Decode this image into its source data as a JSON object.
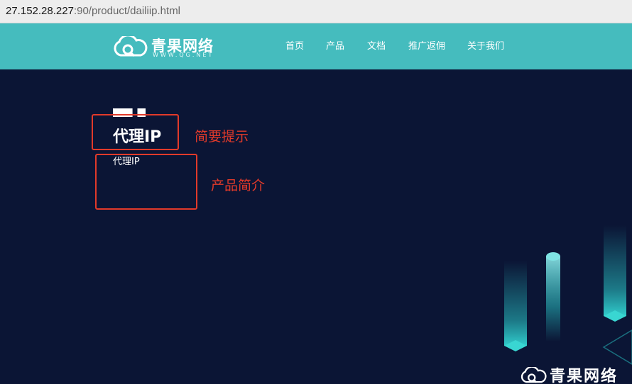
{
  "browser": {
    "url_host": "27.152.28.227",
    "url_rest": ":90/product/dailiip.html"
  },
  "header": {
    "logo_title": "青果网络",
    "logo_subtitle": "WWW.QG.NET",
    "nav": [
      "首页",
      "产品",
      "文档",
      "推广返佣",
      "关于我们"
    ],
    "colors": {
      "header_bg": "#45bcbe",
      "hero_bg": "#0b1535",
      "annotation": "#e23a2a"
    }
  },
  "hero": {
    "title": "代理IP",
    "description": "代理IP"
  },
  "annotations": {
    "title_note": "简要提示",
    "desc_note": "产品简介"
  },
  "watermark": {
    "text": "青果网络"
  }
}
